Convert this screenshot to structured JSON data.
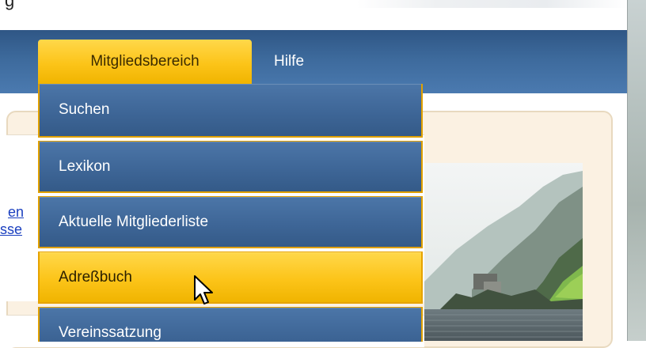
{
  "header": {
    "partial_text": "g"
  },
  "nav": {
    "tabs": [
      {
        "label": "Mitgliedsbereich",
        "active": true
      },
      {
        "label": "Hilfe",
        "active": false
      }
    ]
  },
  "dropdown": {
    "items": [
      {
        "label": "Suchen"
      },
      {
        "label": "Lexikon"
      },
      {
        "label": "Aktuelle Mitgliederliste"
      },
      {
        "label": "Adreßbuch",
        "hovered": true
      },
      {
        "label": "Vereinssatzung"
      }
    ]
  },
  "left_links": [
    {
      "text": "en"
    },
    {
      "text": "sse"
    }
  ],
  "colors": {
    "nav_blue": "#3d6a9c",
    "highlight_yellow": "#fcc419",
    "menu_border": "#e0a000",
    "panel_bg": "#fbf1e2",
    "link_blue": "#1a3fbf"
  },
  "icons": {
    "cursor": "mouse-pointer-icon",
    "image": "landscape-image"
  }
}
